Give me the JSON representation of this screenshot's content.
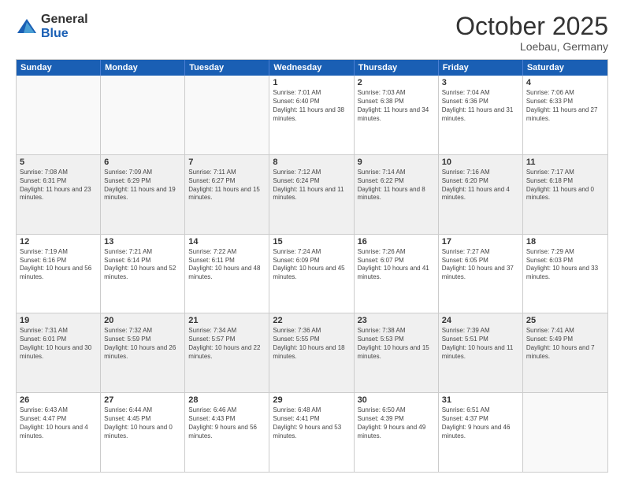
{
  "header": {
    "logo": {
      "general": "General",
      "blue": "Blue"
    },
    "title": "October 2025",
    "location": "Loebau, Germany"
  },
  "weekdays": [
    "Sunday",
    "Monday",
    "Tuesday",
    "Wednesday",
    "Thursday",
    "Friday",
    "Saturday"
  ],
  "rows": [
    {
      "alt": false,
      "cells": [
        {
          "day": "",
          "empty": true
        },
        {
          "day": "",
          "empty": true
        },
        {
          "day": "",
          "empty": true
        },
        {
          "day": "1",
          "sunrise": "7:01 AM",
          "sunset": "6:40 PM",
          "daylight": "11 hours and 38 minutes."
        },
        {
          "day": "2",
          "sunrise": "7:03 AM",
          "sunset": "6:38 PM",
          "daylight": "11 hours and 34 minutes."
        },
        {
          "day": "3",
          "sunrise": "7:04 AM",
          "sunset": "6:36 PM",
          "daylight": "11 hours and 31 minutes."
        },
        {
          "day": "4",
          "sunrise": "7:06 AM",
          "sunset": "6:33 PM",
          "daylight": "11 hours and 27 minutes."
        }
      ]
    },
    {
      "alt": true,
      "cells": [
        {
          "day": "5",
          "sunrise": "7:08 AM",
          "sunset": "6:31 PM",
          "daylight": "11 hours and 23 minutes."
        },
        {
          "day": "6",
          "sunrise": "7:09 AM",
          "sunset": "6:29 PM",
          "daylight": "11 hours and 19 minutes."
        },
        {
          "day": "7",
          "sunrise": "7:11 AM",
          "sunset": "6:27 PM",
          "daylight": "11 hours and 15 minutes."
        },
        {
          "day": "8",
          "sunrise": "7:12 AM",
          "sunset": "6:24 PM",
          "daylight": "11 hours and 11 minutes."
        },
        {
          "day": "9",
          "sunrise": "7:14 AM",
          "sunset": "6:22 PM",
          "daylight": "11 hours and 8 minutes."
        },
        {
          "day": "10",
          "sunrise": "7:16 AM",
          "sunset": "6:20 PM",
          "daylight": "11 hours and 4 minutes."
        },
        {
          "day": "11",
          "sunrise": "7:17 AM",
          "sunset": "6:18 PM",
          "daylight": "11 hours and 0 minutes."
        }
      ]
    },
    {
      "alt": false,
      "cells": [
        {
          "day": "12",
          "sunrise": "7:19 AM",
          "sunset": "6:16 PM",
          "daylight": "10 hours and 56 minutes."
        },
        {
          "day": "13",
          "sunrise": "7:21 AM",
          "sunset": "6:14 PM",
          "daylight": "10 hours and 52 minutes."
        },
        {
          "day": "14",
          "sunrise": "7:22 AM",
          "sunset": "6:11 PM",
          "daylight": "10 hours and 48 minutes."
        },
        {
          "day": "15",
          "sunrise": "7:24 AM",
          "sunset": "6:09 PM",
          "daylight": "10 hours and 45 minutes."
        },
        {
          "day": "16",
          "sunrise": "7:26 AM",
          "sunset": "6:07 PM",
          "daylight": "10 hours and 41 minutes."
        },
        {
          "day": "17",
          "sunrise": "7:27 AM",
          "sunset": "6:05 PM",
          "daylight": "10 hours and 37 minutes."
        },
        {
          "day": "18",
          "sunrise": "7:29 AM",
          "sunset": "6:03 PM",
          "daylight": "10 hours and 33 minutes."
        }
      ]
    },
    {
      "alt": true,
      "cells": [
        {
          "day": "19",
          "sunrise": "7:31 AM",
          "sunset": "6:01 PM",
          "daylight": "10 hours and 30 minutes."
        },
        {
          "day": "20",
          "sunrise": "7:32 AM",
          "sunset": "5:59 PM",
          "daylight": "10 hours and 26 minutes."
        },
        {
          "day": "21",
          "sunrise": "7:34 AM",
          "sunset": "5:57 PM",
          "daylight": "10 hours and 22 minutes."
        },
        {
          "day": "22",
          "sunrise": "7:36 AM",
          "sunset": "5:55 PM",
          "daylight": "10 hours and 18 minutes."
        },
        {
          "day": "23",
          "sunrise": "7:38 AM",
          "sunset": "5:53 PM",
          "daylight": "10 hours and 15 minutes."
        },
        {
          "day": "24",
          "sunrise": "7:39 AM",
          "sunset": "5:51 PM",
          "daylight": "10 hours and 11 minutes."
        },
        {
          "day": "25",
          "sunrise": "7:41 AM",
          "sunset": "5:49 PM",
          "daylight": "10 hours and 7 minutes."
        }
      ]
    },
    {
      "alt": false,
      "cells": [
        {
          "day": "26",
          "sunrise": "6:43 AM",
          "sunset": "4:47 PM",
          "daylight": "10 hours and 4 minutes."
        },
        {
          "day": "27",
          "sunrise": "6:44 AM",
          "sunset": "4:45 PM",
          "daylight": "10 hours and 0 minutes."
        },
        {
          "day": "28",
          "sunrise": "6:46 AM",
          "sunset": "4:43 PM",
          "daylight": "9 hours and 56 minutes."
        },
        {
          "day": "29",
          "sunrise": "6:48 AM",
          "sunset": "4:41 PM",
          "daylight": "9 hours and 53 minutes."
        },
        {
          "day": "30",
          "sunrise": "6:50 AM",
          "sunset": "4:39 PM",
          "daylight": "9 hours and 49 minutes."
        },
        {
          "day": "31",
          "sunrise": "6:51 AM",
          "sunset": "4:37 PM",
          "daylight": "9 hours and 46 minutes."
        },
        {
          "day": "",
          "empty": true
        }
      ]
    }
  ]
}
